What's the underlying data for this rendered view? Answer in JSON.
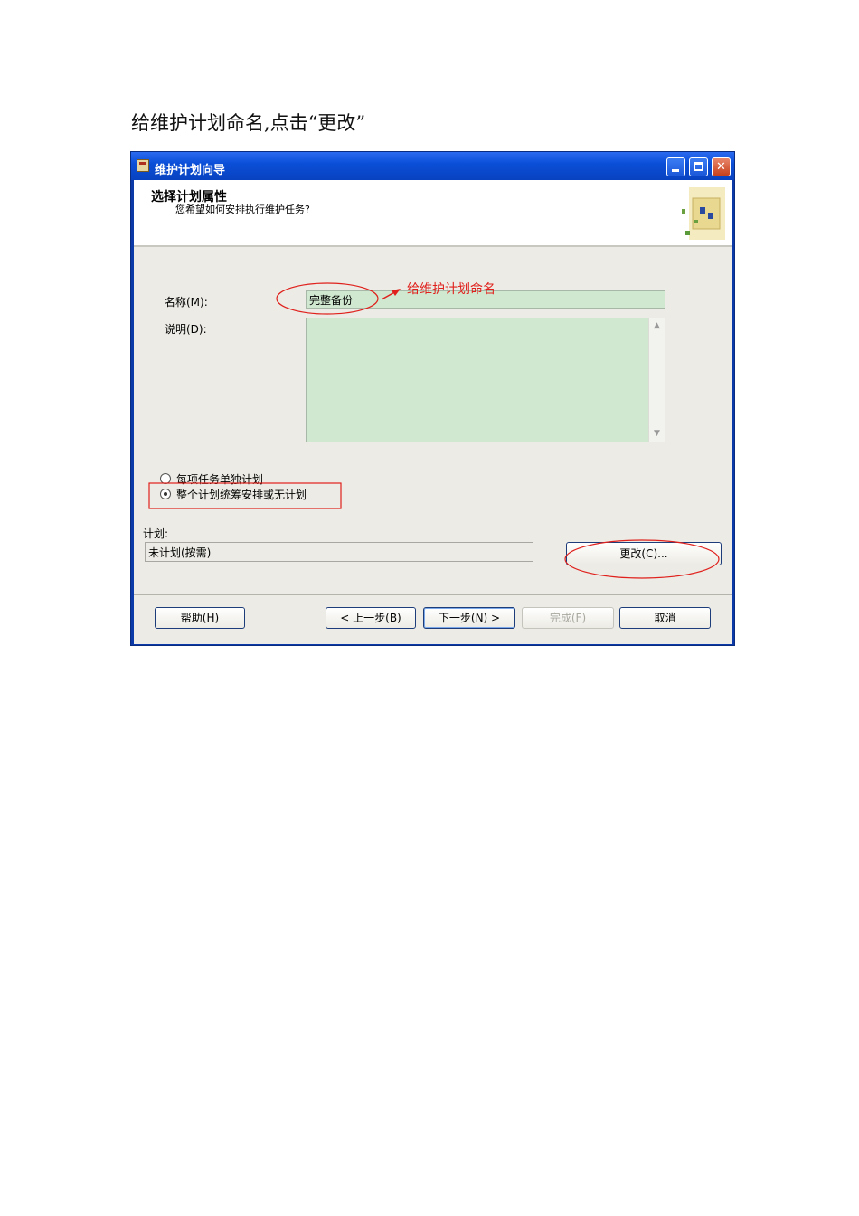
{
  "caption": "给维护计划命名,点击“更改”",
  "window": {
    "title": "维护计划向导"
  },
  "header": {
    "title": "选择计划属性",
    "subtitle": "您希望如何安排执行维护任务?"
  },
  "form": {
    "name_label": "名称(M):",
    "name_value": "完整备份",
    "description_label": "说明(D):",
    "description_value": "",
    "radio_separate": "每项任务单独计划",
    "radio_single": "整个计划统筹安排或无计划",
    "radio_selected": "single",
    "schedule_label": "计划:",
    "schedule_value": "未计划(按需)",
    "change_button": "更改(C)..."
  },
  "annotation": {
    "name_callout": "给维护计划命名",
    "color": "#e0201c"
  },
  "footer": {
    "help": "帮助(H)",
    "back": "< 上一步(B)",
    "next": "下一步(N) >",
    "finish": "完成(F)",
    "cancel": "取消"
  },
  "colors": {
    "titlebar": "#0b4fd8",
    "input_bg": "#cfe8cf",
    "dialog_bg": "#ecebe5"
  }
}
